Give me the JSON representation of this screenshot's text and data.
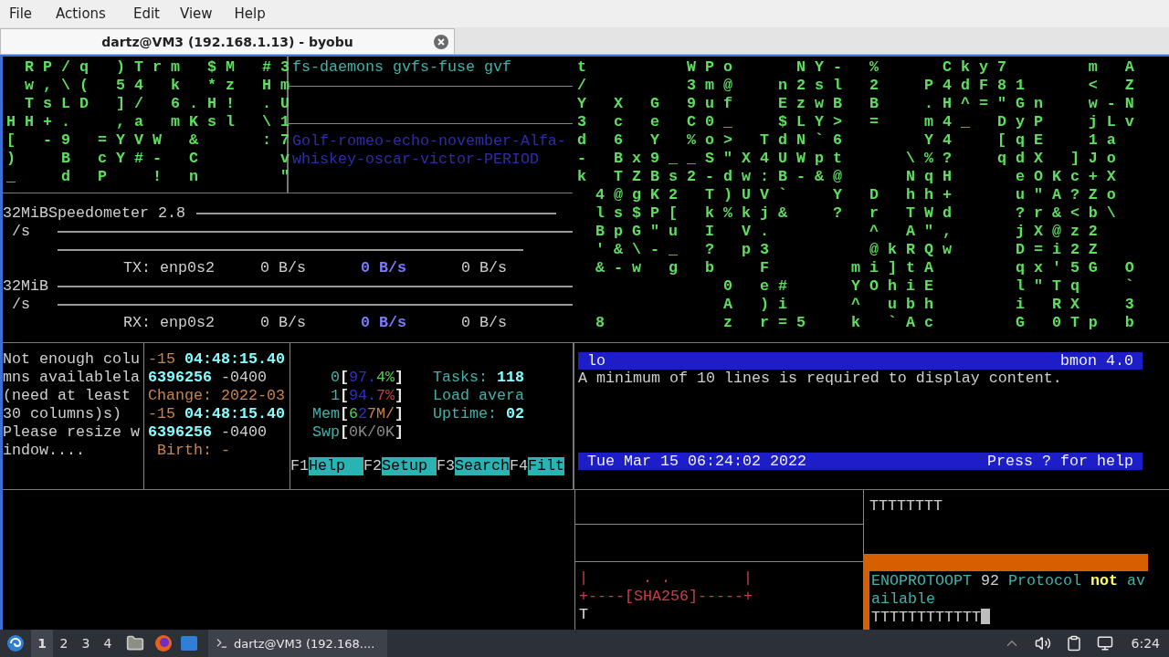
{
  "menu": [
    "File",
    "Actions",
    "Edit",
    "View",
    "Help"
  ],
  "tab": {
    "title": "dartz@VM3 (192.168.1.13) - byobu",
    "selected": true
  },
  "matrix_left": [
    " RP/q )Trm $M #3",
    " w,\\( 54 k *z Hm",
    " TsLD ]/ 6.H! .U",
    "HH+.  ,a mKsl \\1",
    "[ -9 =YVW &   :7",
    ")  B cY#- C    v",
    "_  d P  ! n    \""
  ],
  "process_pane": {
    "text": "fs-daemons gvfs-fuse gvf",
    "note_lines": [
      "Golf-romeo-echo-november-Alfa-",
      "whiskey-oscar-victor-PERIOD"
    ]
  },
  "speedometer": {
    "title": "Speedometer 2.8",
    "graphs": [
      {
        "scale": "32MiB",
        "unit": " /s",
        "label": "TX: enp0s2",
        "readings": [
          {
            "text": "0 B/s",
            "highlight": false
          },
          {
            "text": "0 B/s",
            "highlight": true
          },
          {
            "text": "0 B/s",
            "highlight": false
          }
        ]
      },
      {
        "scale": "32MiB",
        "unit": " /s",
        "label": "RX: enp0s2",
        "readings": [
          {
            "text": "0 B/s",
            "highlight": false
          },
          {
            "text": "0 B/s",
            "highlight": true
          },
          {
            "text": "0 B/s",
            "highlight": false
          }
        ]
      }
    ]
  },
  "matrix_right": [
    "t     WPo   NY- %   Cky7    m A",
    "/     3m@  n2sl 2  P4dF81   < Z",
    "Y X G 9uf  EzwB B  .H^=\"Gn  w-N",
    "3 c e C0_  $LY> =  m4_ DyP  jLv",
    "d 6 Y %o> TdN`6    Y4  [qE  1a",
    "- Bx9__S\"X4UWpt   \\%?  qdX ]Jo",
    "k TZBs2-dw:B-&@   NqH   eOKc+X",
    " 4@gK2 T)UV`  Y D hh+   u\"A?Zo",
    " ls$P[ k%kj&  ? r TWd   ?r&<b\\",
    " BpG\"u I V.     ^ A\",   jX@z2",
    " '&\\-_ ? p3     @kRQw   D=i2Z",
    " &-w g b  F    mi]tA    qx'5G O",
    "        0 e#   YOhiE    l\"Tq  `",
    "        A )i   ^ ubh    i RX  3",
    " 8      z r=5  k `Ac    G 0Tp b"
  ],
  "warning_lines": [
    "Not enough colu",
    "mns availablela",
    "(need at least ",
    "30 columns)s)",
    "Please resize w",
    "indow...."
  ],
  "stat_lines": [
    [
      {
        "text": "-15 ",
        "color": "#c8864a",
        "bold": false
      },
      {
        "text": "04:48:15.40",
        "color": "#86ffff",
        "bold": true
      }
    ],
    [
      {
        "text": "6396256",
        "color": "#86ffff",
        "bold": true
      },
      {
        "text": " -0400",
        "color": "#cfcfcf",
        "bold": false
      }
    ],
    [
      {
        "text": "Change: 2022-03",
        "color": "#c8864a",
        "bold": false
      }
    ],
    [
      {
        "text": "-15 ",
        "color": "#c8864a",
        "bold": false
      },
      {
        "text": "04:48:15.40",
        "color": "#86ffff",
        "bold": true
      }
    ],
    [
      {
        "text": "6396256",
        "color": "#86ffff",
        "bold": true
      },
      {
        "text": " -0400",
        "color": "#cfcfcf",
        "bold": false
      }
    ],
    [
      {
        "text": " Birth: -",
        "color": "#c8864a",
        "bold": false
      }
    ]
  ],
  "htop": {
    "meters": [
      {
        "label": "0",
        "open": "[",
        "value": [
          {
            "text": "97.",
            "color": "#3030c4",
            "bold": false
          },
          {
            "text": "4%",
            "color": "#56d056",
            "bold": false
          }
        ],
        "close": "]"
      },
      {
        "label": "1",
        "open": "[",
        "value": [
          {
            "text": "94.",
            "color": "#3030c4",
            "bold": false
          },
          {
            "text": "7%",
            "color": "#c2404e",
            "bold": false
          }
        ],
        "close": "]"
      },
      {
        "label": "Mem",
        "open": "[",
        "value": [
          {
            "text": "6",
            "color": "#56d056",
            "bold": false
          },
          {
            "text": "2",
            "color": "#3030c4",
            "bold": false
          },
          {
            "text": "7M/",
            "color": "#c8864a",
            "bold": false
          }
        ],
        "close": "]"
      },
      {
        "label": "Swp",
        "open": "[",
        "value": [
          {
            "text": "0K/0K",
            "color": "#8a8a8a",
            "bold": false
          }
        ],
        "close": "]"
      }
    ],
    "info": [
      [
        {
          "text": "Tasks: ",
          "color": "#3fb3aa",
          "bold": false
        },
        {
          "text": "118",
          "color": "#86ffff",
          "bold": true
        }
      ],
      [
        {
          "text": "Load avera",
          "color": "#3fb3aa",
          "bold": false
        }
      ],
      [
        {
          "text": "Uptime: ",
          "color": "#3fb3aa",
          "bold": false
        },
        {
          "text": "02",
          "color": "#86ffff",
          "bold": true
        }
      ]
    ],
    "keys": [
      {
        "key": "F1",
        "action": "Help  "
      },
      {
        "key": "F2",
        "action": "Setup "
      },
      {
        "key": "F3",
        "action": "Search"
      },
      {
        "key": "F4",
        "action": "Filt"
      }
    ]
  },
  "bmon": {
    "interface": "lo",
    "version": "bmon 4.0",
    "message": "A minimum of 10 lines is required to display content.",
    "clock": "Tue Mar 15 06:24:02 2022",
    "help": "Press ? for help"
  },
  "hash_art": [
    "|      . .        |",
    "+----[SHA256]-----+"
  ],
  "hash_prompt": "T",
  "right_text": "TTTTTTTT",
  "popup": {
    "lines": [
      [
        {
          "text": "ENOPROTOOPT",
          "color": "#3fb3aa",
          "bold": false
        },
        {
          "text": " 92 ",
          "color": "#cfcfcf",
          "bold": false
        },
        {
          "text": "Protocol ",
          "color": "#3fb3aa",
          "bold": false
        },
        {
          "text": "not",
          "color": "#ffff55",
          "bold": true
        },
        {
          "text": " av",
          "color": "#3fb3aa",
          "bold": false
        }
      ],
      [
        {
          "text": "ailable",
          "color": "#3fb3aa",
          "bold": false
        }
      ],
      [
        {
          "text": "TTTTTTTTTTTT",
          "color": "#cfcfcf",
          "bold": false
        }
      ]
    ],
    "cursor": true
  },
  "taskbar": {
    "workspaces": [
      {
        "label": "1",
        "selected": true
      },
      {
        "label": "2",
        "selected": false
      },
      {
        "label": "3",
        "selected": false
      },
      {
        "label": "4",
        "selected": false
      }
    ],
    "window": "dartz@VM3 (192.168....",
    "clock": "6:24"
  }
}
